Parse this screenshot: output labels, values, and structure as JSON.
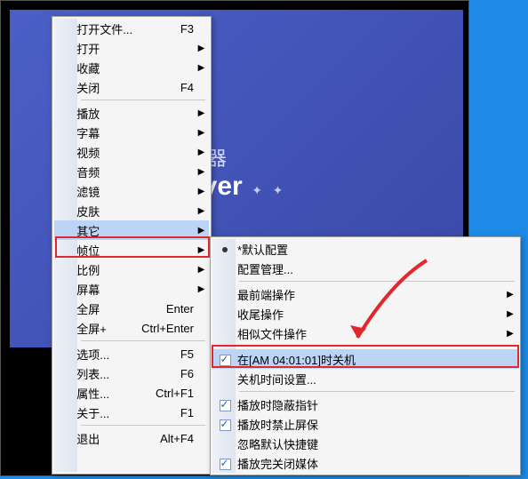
{
  "background": {
    "text1": "放器",
    "text2": "ayer"
  },
  "mainMenu": [
    {
      "label": "打开文件...",
      "shortcut": "F3",
      "arrow": false
    },
    {
      "label": "打开",
      "shortcut": "",
      "arrow": true
    },
    {
      "label": "收藏",
      "shortcut": "",
      "arrow": true
    },
    {
      "label": "关闭",
      "shortcut": "F4",
      "arrow": false
    },
    {
      "sep": true
    },
    {
      "label": "播放",
      "shortcut": "",
      "arrow": true
    },
    {
      "label": "字幕",
      "shortcut": "",
      "arrow": true
    },
    {
      "label": "视频",
      "shortcut": "",
      "arrow": true
    },
    {
      "label": "音频",
      "shortcut": "",
      "arrow": true
    },
    {
      "label": "滤镜",
      "shortcut": "",
      "arrow": true
    },
    {
      "label": "皮肤",
      "shortcut": "",
      "arrow": true
    },
    {
      "label": "其它",
      "shortcut": "",
      "arrow": true,
      "highlight": true
    },
    {
      "label": "帧位",
      "shortcut": "",
      "arrow": true
    },
    {
      "label": "比例",
      "shortcut": "",
      "arrow": true
    },
    {
      "label": "屏幕",
      "shortcut": "",
      "arrow": true
    },
    {
      "label": "全屏",
      "shortcut": "Enter",
      "arrow": false
    },
    {
      "label": "全屏+",
      "shortcut": "Ctrl+Enter",
      "arrow": false
    },
    {
      "sep": true
    },
    {
      "label": "选项...",
      "shortcut": "F5",
      "arrow": false
    },
    {
      "label": "列表...",
      "shortcut": "F6",
      "arrow": false
    },
    {
      "label": "属性...",
      "shortcut": "Ctrl+F1",
      "arrow": false
    },
    {
      "label": "关于...",
      "shortcut": "F1",
      "arrow": false
    },
    {
      "sep": true
    },
    {
      "label": "退出",
      "shortcut": "Alt+F4",
      "arrow": false
    }
  ],
  "subMenu": [
    {
      "label": "*默认配置",
      "icon": "dot"
    },
    {
      "label": "配置管理..."
    },
    {
      "sep": true
    },
    {
      "label": "最前端操作",
      "arrow": true
    },
    {
      "label": "收尾操作",
      "arrow": true
    },
    {
      "label": "相似文件操作",
      "arrow": true
    },
    {
      "sep": true
    },
    {
      "label": "在[AM 04:01:01]时关机",
      "icon": "check-on",
      "highlight": true
    },
    {
      "label": "关机时间设置..."
    },
    {
      "sep": true
    },
    {
      "label": "播放时隐蔽指针",
      "icon": "check-on"
    },
    {
      "label": "播放时禁止屏保",
      "icon": "check-on"
    },
    {
      "label": "忽略默认快捷键"
    },
    {
      "label": "播放完关闭媒体",
      "icon": "check-on"
    }
  ]
}
